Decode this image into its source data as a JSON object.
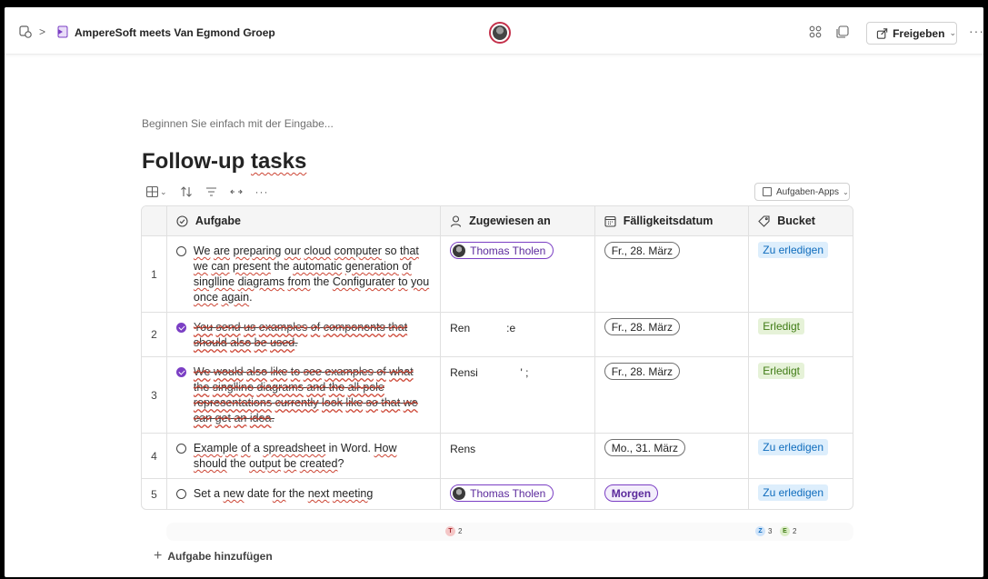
{
  "header": {
    "breadcrumb_sep": ">",
    "doc_title": "AmpereSoft meets Van Egmond Groep",
    "share_label": "Freigeben",
    "more": "···"
  },
  "content": {
    "placeholder": "Beginnen Sie einfach mit der Eingabe...",
    "title_a": "Follow-up ",
    "title_b": "tasks",
    "apps_label": "Aufgaben-Apps"
  },
  "table": {
    "columns": {
      "task": "Aufgabe",
      "assigned": "Zugewiesen an",
      "due": "Fälligkeitsdatum",
      "bucket": "Bucket"
    },
    "rows": [
      {
        "num": "1",
        "assigned": "Thomas Tholen",
        "due": "Fr., 28. März",
        "bucket": "Zu erledigen"
      },
      {
        "num": "2",
        "assigned": "Ren            :e",
        "due": "Fr., 28. März",
        "bucket": "Erledigt"
      },
      {
        "num": "3",
        "assigned": "Rensi              ' ;",
        "due": "Fr., 28. März",
        "bucket": "Erledigt"
      },
      {
        "num": "4",
        "assigned": "Rens",
        "due": "Mo., 31. März",
        "bucket": "Zu erledigen"
      },
      {
        "num": "5",
        "assigned": "Thomas Tholen",
        "due": "Morgen",
        "bucket": "Zu erledigen"
      }
    ]
  },
  "summary": {
    "t_badge": "T",
    "t_count": "2",
    "z_badge": "Z",
    "z_count": "3",
    "e_badge": "E",
    "e_count": "2"
  },
  "add_task_label": "Aufgabe hinzufügen",
  "colors": {
    "accent_purple": "#7b3fc4",
    "todo_blue": "#0f6cbd",
    "done_green": "#407c16"
  }
}
